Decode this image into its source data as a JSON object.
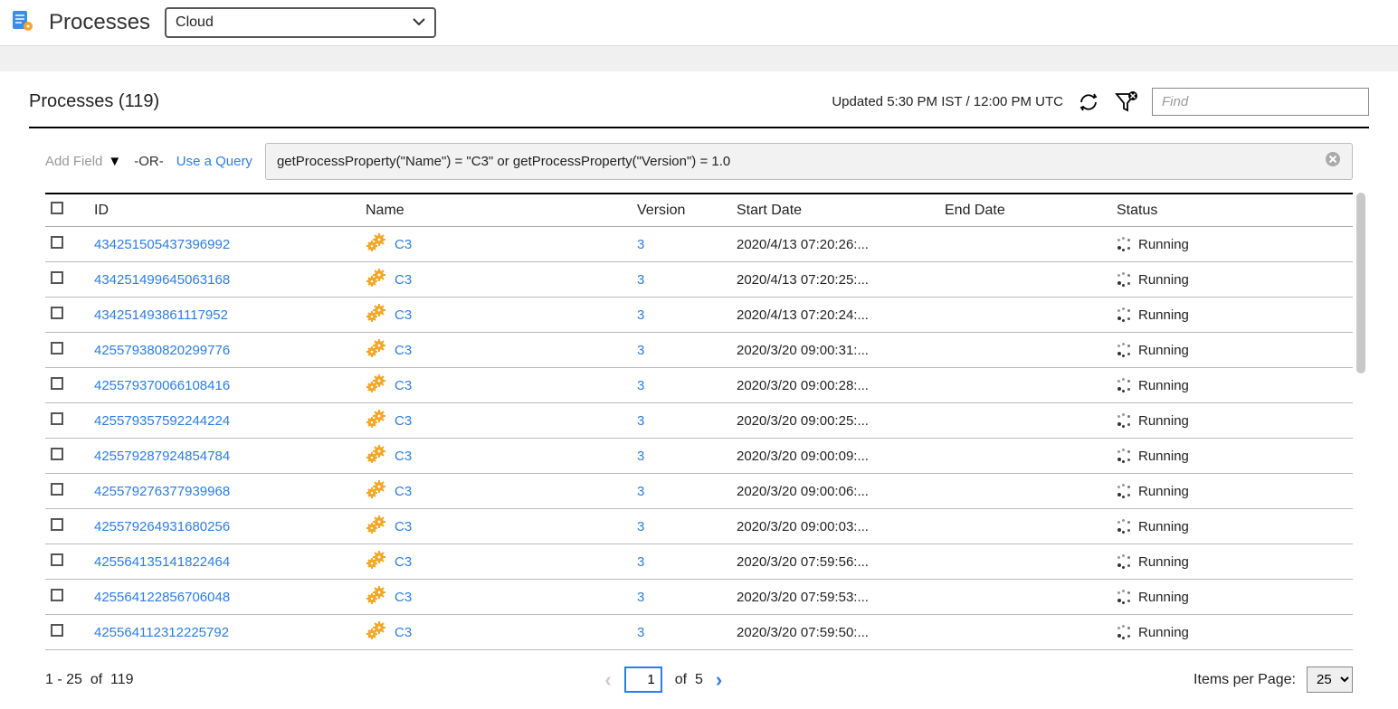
{
  "header": {
    "title": "Processes",
    "env_selected": "Cloud"
  },
  "subheader": {
    "title_prefix": "Processes (",
    "total": "119",
    "title_suffix": ")",
    "updated": "Updated 5:30 PM IST / 12:00 PM UTC",
    "find_placeholder": "Find"
  },
  "filter": {
    "add_field": "Add Field",
    "or": "-OR-",
    "use_query": "Use a Query",
    "query": "getProcessProperty(\"Name\") = \"C3\" or  getProcessProperty(\"Version\") = 1.0"
  },
  "columns": {
    "id": "ID",
    "name": "Name",
    "version": "Version",
    "start": "Start Date",
    "end": "End Date",
    "status": "Status"
  },
  "rows": [
    {
      "id": "434251505437396992",
      "name": "C3",
      "version": "3",
      "start": "2020/4/13 07:20:26:...",
      "end": "",
      "status": "Running"
    },
    {
      "id": "434251499645063168",
      "name": "C3",
      "version": "3",
      "start": "2020/4/13 07:20:25:...",
      "end": "",
      "status": "Running"
    },
    {
      "id": "434251493861117952",
      "name": "C3",
      "version": "3",
      "start": "2020/4/13 07:20:24:...",
      "end": "",
      "status": "Running"
    },
    {
      "id": "425579380820299776",
      "name": "C3",
      "version": "3",
      "start": "2020/3/20 09:00:31:...",
      "end": "",
      "status": "Running"
    },
    {
      "id": "425579370066108416",
      "name": "C3",
      "version": "3",
      "start": "2020/3/20 09:00:28:...",
      "end": "",
      "status": "Running"
    },
    {
      "id": "425579357592244224",
      "name": "C3",
      "version": "3",
      "start": "2020/3/20 09:00:25:...",
      "end": "",
      "status": "Running"
    },
    {
      "id": "425579287924854784",
      "name": "C3",
      "version": "3",
      "start": "2020/3/20 09:00:09:...",
      "end": "",
      "status": "Running"
    },
    {
      "id": "425579276377939968",
      "name": "C3",
      "version": "3",
      "start": "2020/3/20 09:00:06:...",
      "end": "",
      "status": "Running"
    },
    {
      "id": "425579264931680256",
      "name": "C3",
      "version": "3",
      "start": "2020/3/20 09:00:03:...",
      "end": "",
      "status": "Running"
    },
    {
      "id": "425564135141822464",
      "name": "C3",
      "version": "3",
      "start": "2020/3/20 07:59:56:...",
      "end": "",
      "status": "Running"
    },
    {
      "id": "425564122856706048",
      "name": "C3",
      "version": "3",
      "start": "2020/3/20 07:59:53:...",
      "end": "",
      "status": "Running"
    },
    {
      "id": "425564112312225792",
      "name": "C3",
      "version": "3",
      "start": "2020/3/20 07:59:50:...",
      "end": "",
      "status": "Running"
    }
  ],
  "footer": {
    "range": "1 - 25",
    "of_label": "of",
    "total": "119",
    "page": "1",
    "pages": "5",
    "ipp_label": "Items per Page:",
    "ipp_value": "25"
  }
}
